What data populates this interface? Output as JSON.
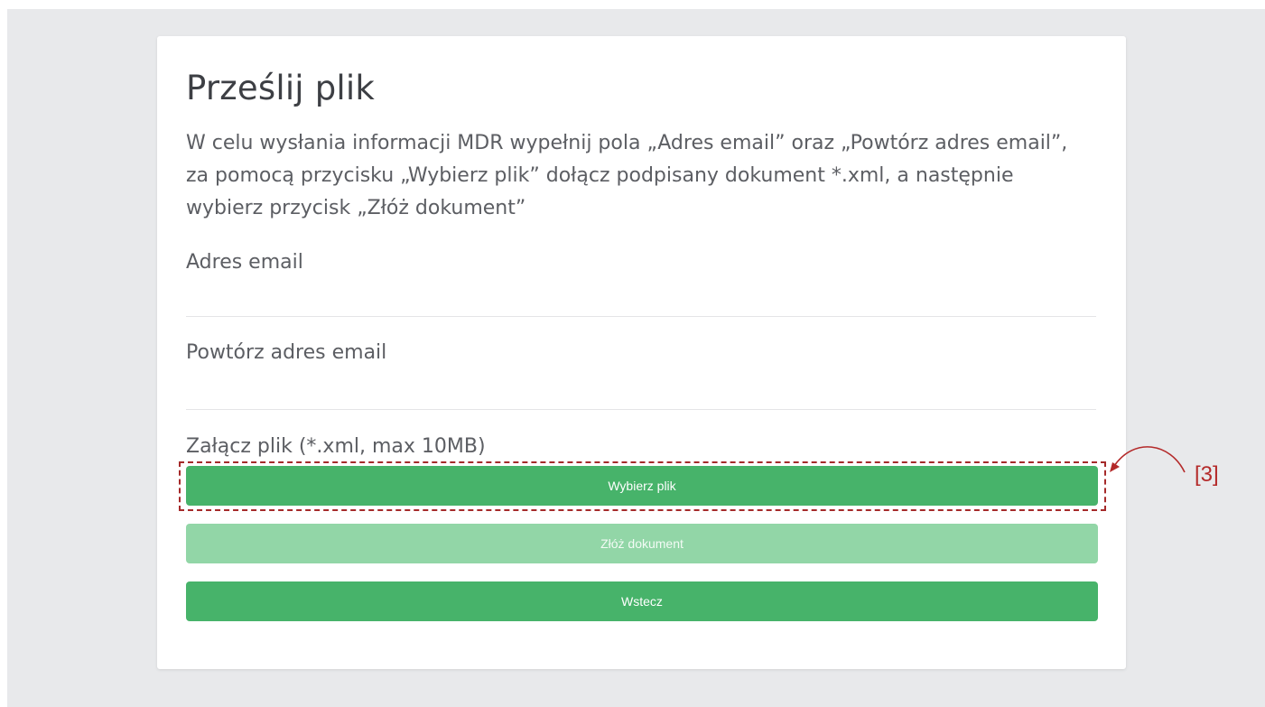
{
  "form": {
    "title": "Prześlij plik",
    "description": "W celu wysłania informacji MDR wypełnij pola „Adres email” oraz „Powtórz adres email”, za pomocą przycisku „Wybierz plik” dołącz podpisany dokument *.xml, a następnie wybierz przycisk „Złóż dokument”",
    "email_label": "Adres email",
    "email_value": "",
    "repeat_email_label": "Powtórz adres email",
    "repeat_email_value": "",
    "attach_label": "Załącz plik (*.xml, max 10MB)",
    "choose_file_label": "Wybierz plik",
    "submit_label": "Złóż dokument",
    "back_label": "Wstecz"
  },
  "annotation": {
    "label": "[3]",
    "color": "#b42a2a"
  },
  "colors": {
    "primary_button": "#47b36a",
    "disabled_button": "#92d6a7",
    "background": "#e8e9eb"
  }
}
